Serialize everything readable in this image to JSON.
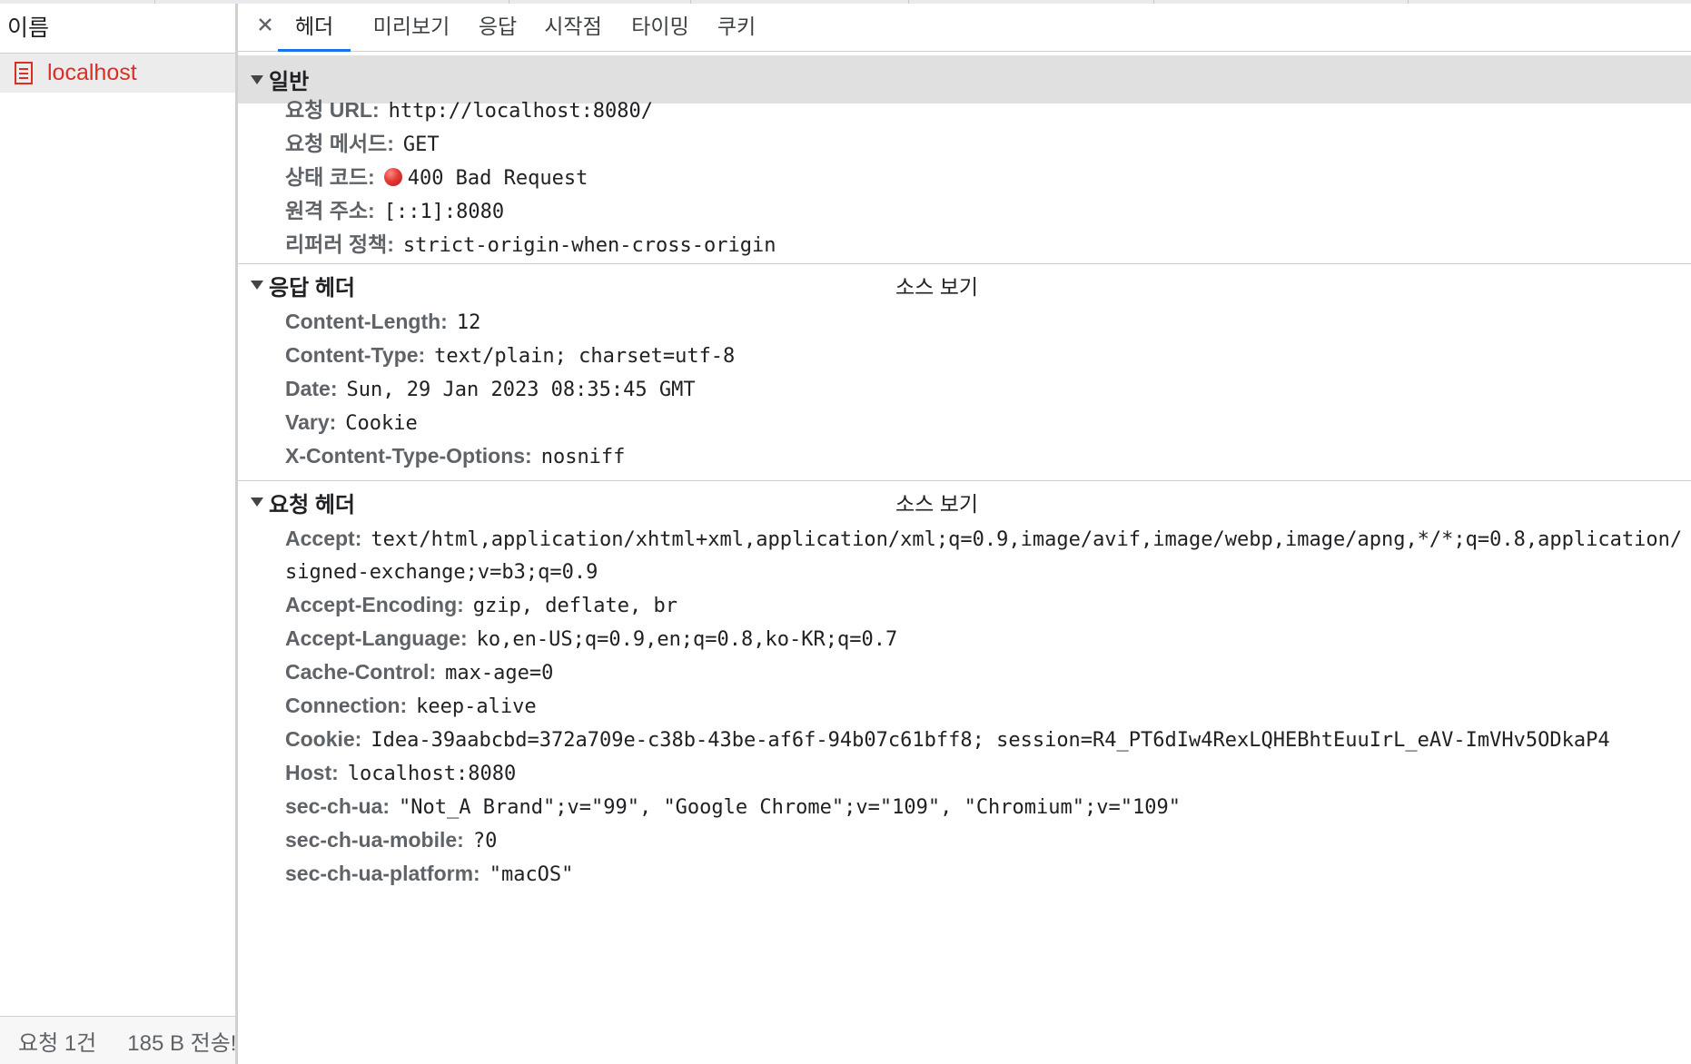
{
  "left_pane": {
    "header": "이름",
    "requests": [
      {
        "name": "localhost"
      }
    ],
    "status": {
      "count": "요청 1건",
      "transfer": "185 B 전송!"
    }
  },
  "tabs": [
    "헤더",
    "미리보기",
    "응답",
    "시작점",
    "타이밍",
    "쿠키"
  ],
  "active_tab": "헤더",
  "general": {
    "title": "일반",
    "rows": [
      {
        "key": "요청 URL:",
        "value": "http://localhost:8080/"
      },
      {
        "key": "요청 메서드:",
        "value": "GET"
      },
      {
        "key": "상태 코드:",
        "value": "400 Bad Request"
      },
      {
        "key": "원격 주소:",
        "value": "[::1]:8080"
      },
      {
        "key": "리퍼러 정책:",
        "value": "strict-origin-when-cross-origin"
      }
    ]
  },
  "response_headers": {
    "title": "응답 헤더",
    "view_source": "소스 보기",
    "rows": [
      {
        "key": "Content-Length:",
        "value": "12"
      },
      {
        "key": "Content-Type:",
        "value": "text/plain; charset=utf-8"
      },
      {
        "key": "Date:",
        "value": "Sun, 29 Jan 2023 08:35:45 GMT"
      },
      {
        "key": "Vary:",
        "value": "Cookie"
      },
      {
        "key": "X-Content-Type-Options:",
        "value": "nosniff"
      }
    ]
  },
  "request_headers": {
    "title": "요청 헤더",
    "view_source": "소스 보기",
    "accept": {
      "key": "Accept:",
      "value_line1": "text/html,application/xhtml+xml,application/xml;q=0.9,image/avif,image/webp,image/apng,*/*;q=0.8,application/",
      "value_line2": "signed-exchange;v=b3;q=0.9"
    },
    "rows": [
      {
        "key": "Accept-Encoding:",
        "value": "gzip, deflate, br"
      },
      {
        "key": "Accept-Language:",
        "value": "ko,en-US;q=0.9,en;q=0.8,ko-KR;q=0.7"
      },
      {
        "key": "Cache-Control:",
        "value": "max-age=0"
      },
      {
        "key": "Connection:",
        "value": "keep-alive"
      },
      {
        "key": "Cookie:",
        "value": "Idea-39aabcbd=372a709e-c38b-43be-af6f-94b07c61bff8; session=R4_PT6dIw4RexLQHEBhtEuuIrL_eAV-ImVHv5ODkaP4"
      },
      {
        "key": "Host:",
        "value": "localhost:8080"
      },
      {
        "key": "sec-ch-ua:",
        "value": "\"Not_A Brand\";v=\"99\", \"Google Chrome\";v=\"109\", \"Chromium\";v=\"109\""
      },
      {
        "key": "sec-ch-ua-mobile:",
        "value": "?0"
      },
      {
        "key": "sec-ch-ua-platform:",
        "value": "\"macOS\""
      }
    ]
  },
  "colors": {
    "error_text": "#d93025",
    "active_tab": "#1a73e8",
    "status_dot": "#e53935"
  }
}
